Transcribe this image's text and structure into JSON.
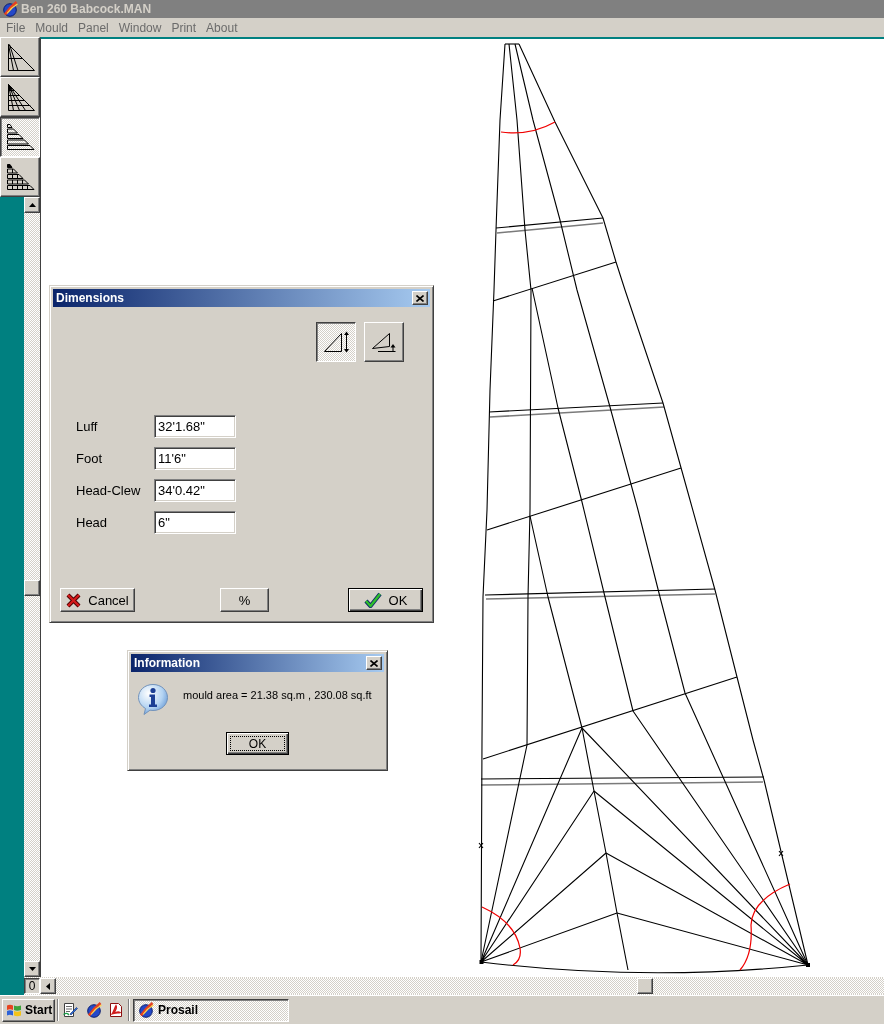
{
  "window": {
    "title": "Ben 260 Babcock.MAN",
    "active": false
  },
  "menu": [
    "File",
    "Mould",
    "Panel",
    "Window",
    "Print",
    "About"
  ],
  "toolbar": [
    {
      "kind": "sections",
      "selected": false
    },
    {
      "kind": "mesh",
      "selected": false
    },
    {
      "kind": "strips",
      "selected": true
    },
    {
      "kind": "stripmesh",
      "selected": false
    }
  ],
  "horizontal_scrollbar": {
    "label": "0"
  },
  "dimensions_dialog": {
    "title": "Dimensions",
    "view_toggles": [
      {
        "kind": "height",
        "selected": true
      },
      {
        "kind": "base",
        "selected": false
      }
    ],
    "fields": [
      {
        "label": "Luff",
        "value": "32'1.68\""
      },
      {
        "label": "Foot",
        "value": "11'6\""
      },
      {
        "label": "Head-Clew",
        "value": "34'0.42\""
      },
      {
        "label": "Head",
        "value": "6\""
      }
    ],
    "buttons": [
      {
        "kind": "cancel",
        "label": "Cancel",
        "default": false
      },
      {
        "kind": "percent",
        "label": "%",
        "default": false
      },
      {
        "kind": "ok",
        "label": "OK",
        "default": true
      }
    ]
  },
  "information_dialog": {
    "title": "Information",
    "message": "mould area = 21.38 sq.m , 230.08 sq.ft",
    "button": {
      "label": "OK",
      "focused": true
    }
  },
  "taskbar": {
    "start": "Start",
    "tasks": [
      {
        "label": "Prosail",
        "selected": true
      }
    ]
  }
}
